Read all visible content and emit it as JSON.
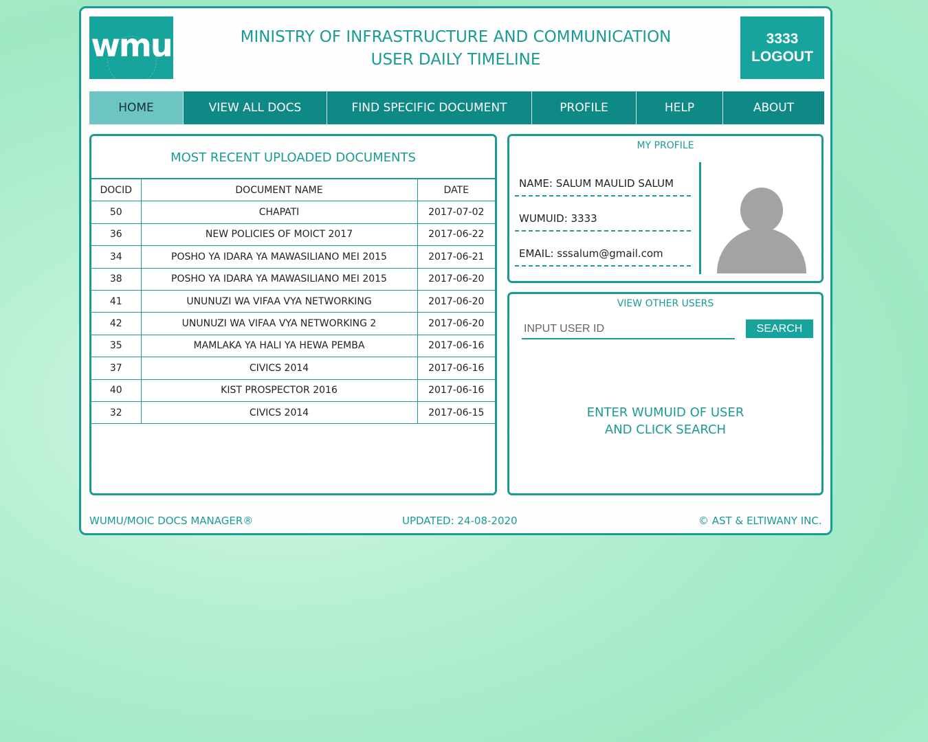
{
  "logo": {
    "text": "wmu"
  },
  "header": {
    "title": "MINISTRY OF INFRASTRUCTURE AND COMMUNICATION",
    "subtitle": "USER DAILY TIMELINE"
  },
  "account": {
    "user_id": "3333",
    "logout_label": "LOGOUT"
  },
  "nav": {
    "items": [
      {
        "label": "HOME",
        "active": true
      },
      {
        "label": "VIEW ALL DOCS"
      },
      {
        "label": "FIND SPECIFIC DOCUMENT"
      },
      {
        "label": "PROFILE"
      },
      {
        "label": "HELP"
      },
      {
        "label": "ABOUT"
      }
    ]
  },
  "recent_docs": {
    "title": "MOST RECENT UPLOADED DOCUMENTS",
    "columns": [
      "DOCID",
      "DOCUMENT NAME",
      "DATE"
    ],
    "rows": [
      [
        "50",
        "CHAPATI",
        "2017-07-02"
      ],
      [
        "36",
        "NEW POLICIES OF MOICT 2017",
        "2017-06-22"
      ],
      [
        "34",
        "POSHO YA IDARA YA MAWASILIANO MEI 2015",
        "2017-06-21"
      ],
      [
        "38",
        "POSHO YA IDARA YA MAWASILIANO MEI 2015",
        "2017-06-20"
      ],
      [
        "41",
        "UNUNUZI WA VIFAA VYA NETWORKING",
        "2017-06-20"
      ],
      [
        "42",
        "UNUNUZI WA VIFAA VYA NETWORKING 2",
        "2017-06-20"
      ],
      [
        "35",
        "MAMLAKA YA HALI YA HEWA PEMBA",
        "2017-06-16"
      ],
      [
        "37",
        "CIVICS 2014",
        "2017-06-16"
      ],
      [
        "40",
        "KIST PROSPECTOR 2016",
        "2017-06-16"
      ],
      [
        "32",
        "CIVICS 2014",
        "2017-06-15"
      ]
    ]
  },
  "profile": {
    "title": "MY PROFILE",
    "name": "NAME: SALUM MAULID SALUM",
    "wumuid": "WUMUID: 3333",
    "email": "EMAIL: sssalum@gmail.com",
    "avatar_icon": "user-silhouette-icon"
  },
  "other_users": {
    "title": "VIEW OTHER USERS",
    "input_placeholder": "INPUT USER ID",
    "search_label": "SEARCH",
    "hint": "ENTER WUMUID OF USER\nAND CLICK SEARCH"
  },
  "footer": {
    "left": "WUMU/MOIC DOCS MANAGER®",
    "center": "UPDATED: 24-08-2020",
    "right": "© AST & ELTIWANY INC."
  },
  "colors": {
    "accent": "#1a9b94",
    "nav_bg": "#0f8985",
    "nav_active": "#6cc5c1",
    "logo_bg": "#17a49c"
  }
}
